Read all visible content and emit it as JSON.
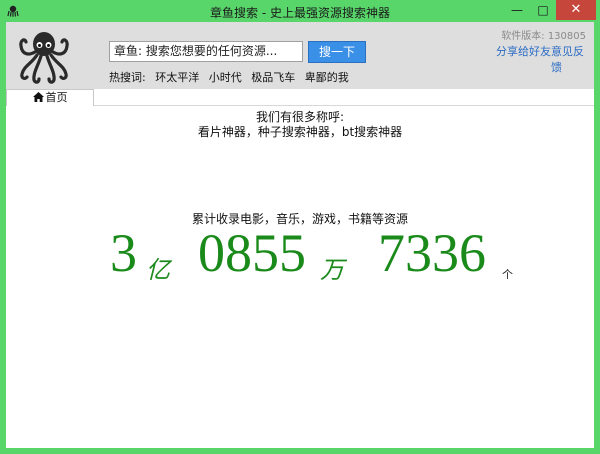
{
  "window": {
    "title": "章鱼搜索 - 史上最强资源搜索神器",
    "min_glyph": "—",
    "max_glyph": "□",
    "close_glyph": "✕"
  },
  "header": {
    "search_value": "章鱼: 搜索您想要的任何资源...",
    "search_button": "搜一下",
    "hot_label": "热搜词:",
    "hot_words": [
      "环太平洋",
      "小时代",
      "极品飞车",
      "卑鄙的我"
    ],
    "version": "软件版本: 130805",
    "share": "分享给好友",
    "feedback": "意见反馈"
  },
  "tabs": {
    "home": "首页"
  },
  "main": {
    "intro_line1": "我们有很多称呼:",
    "intro_line2": "看片神器，种子搜索神器，bt搜索神器",
    "collect_text": "累计收录电影，音乐，游戏，书籍等资源",
    "count": {
      "yi_value": "3",
      "yi_unit": "亿",
      "wan_value": "0855",
      "wan_unit": "万",
      "ge_value": "7336",
      "ge_unit": "个"
    }
  },
  "colors": {
    "frame": "#58d66a",
    "count": "#1a8a1a",
    "link": "#2b6cc4",
    "search_button": "#3a8fe6"
  },
  "icons": {
    "app": "octopus-icon",
    "home": "home-icon",
    "logo": "octopus-logo"
  }
}
